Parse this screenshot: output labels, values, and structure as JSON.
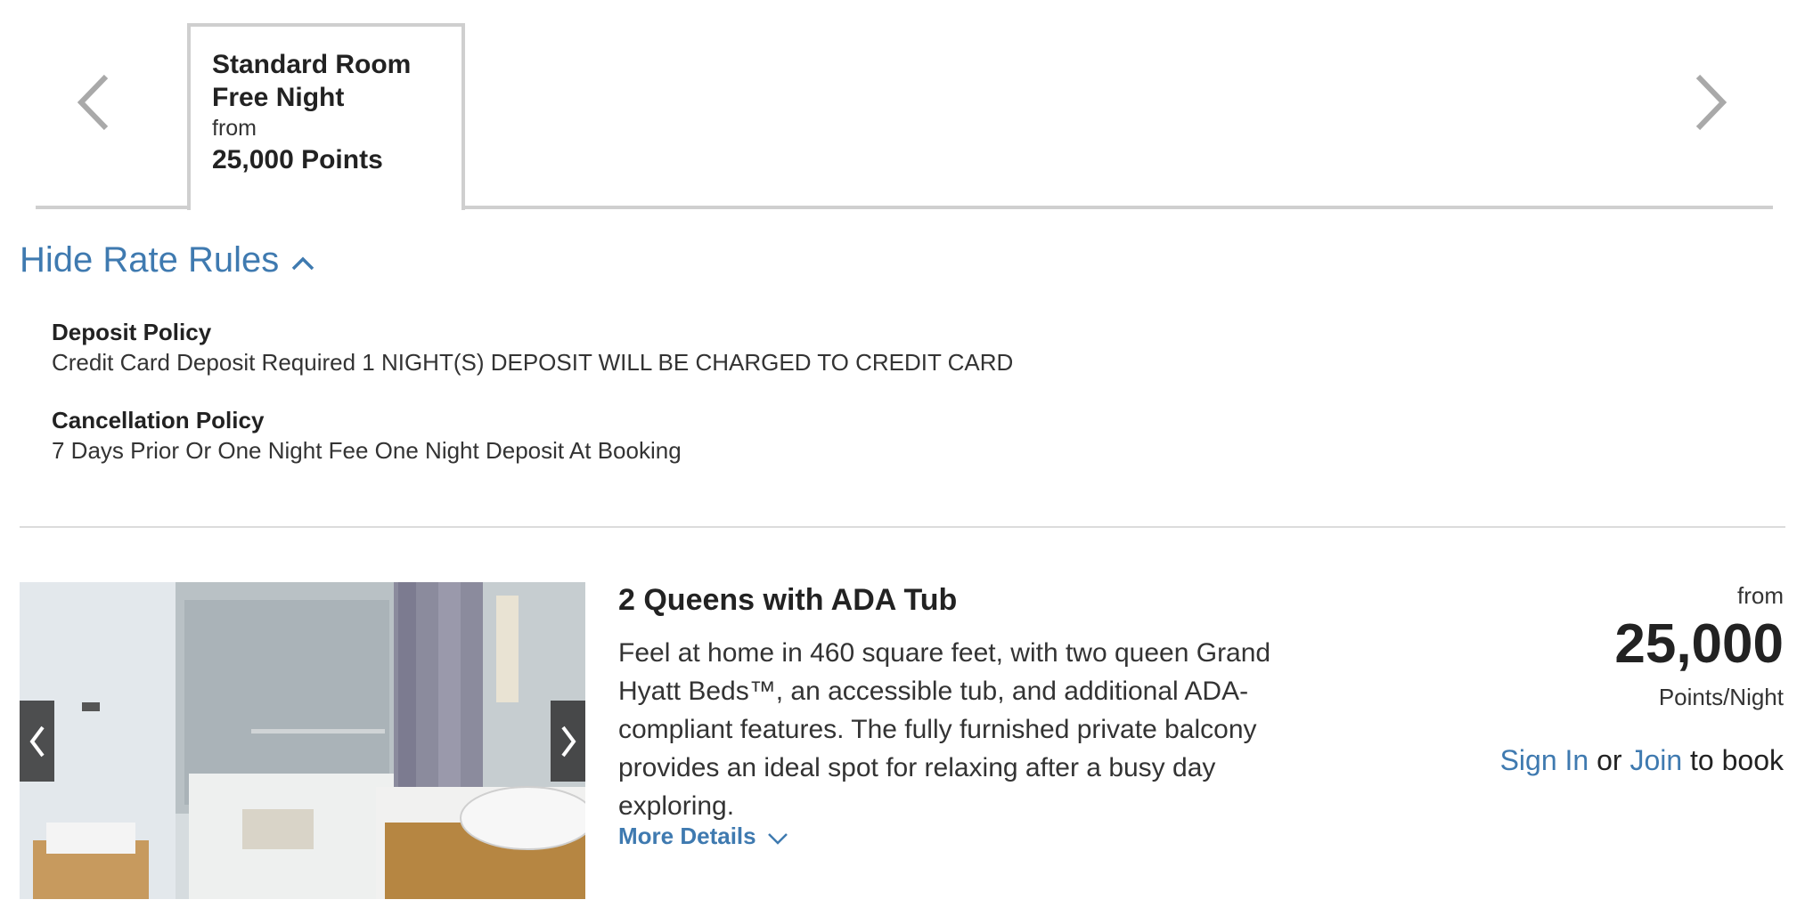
{
  "rate_tabs": {
    "items": [
      {
        "name_line1": "Standard Room",
        "name_line2": "Free Night",
        "from_label": "from",
        "points": "25,000 Points"
      }
    ]
  },
  "rate_rules": {
    "toggle_label": "Hide Rate Rules",
    "deposit_title": "Deposit Policy",
    "deposit_text": "Credit Card Deposit Required 1 NIGHT(S) DEPOSIT WILL BE CHARGED TO CREDIT CARD",
    "cancellation_title": "Cancellation Policy",
    "cancellation_text": "7 Days Prior Or One Night Fee One Night Deposit At Booking"
  },
  "room": {
    "title": "2 Queens with ADA Tub",
    "description": "Feel at home in 460 square feet, with two queen Grand Hyatt Beds™, an accessible tub, and additional ADA-compliant features. The fully furnished private balcony provides an ideal spot for relaxing after a busy day exploring.",
    "more_details_label": "More Details",
    "price_from": "from",
    "price_points": "25,000",
    "price_unit": "Points/Night",
    "sign_in_label": "Sign In",
    "or_label": "or",
    "join_label": "Join",
    "to_book_label": "to book"
  },
  "colors": {
    "link": "#3f7ab0",
    "text": "#222222",
    "border": "#cfcfcf"
  }
}
